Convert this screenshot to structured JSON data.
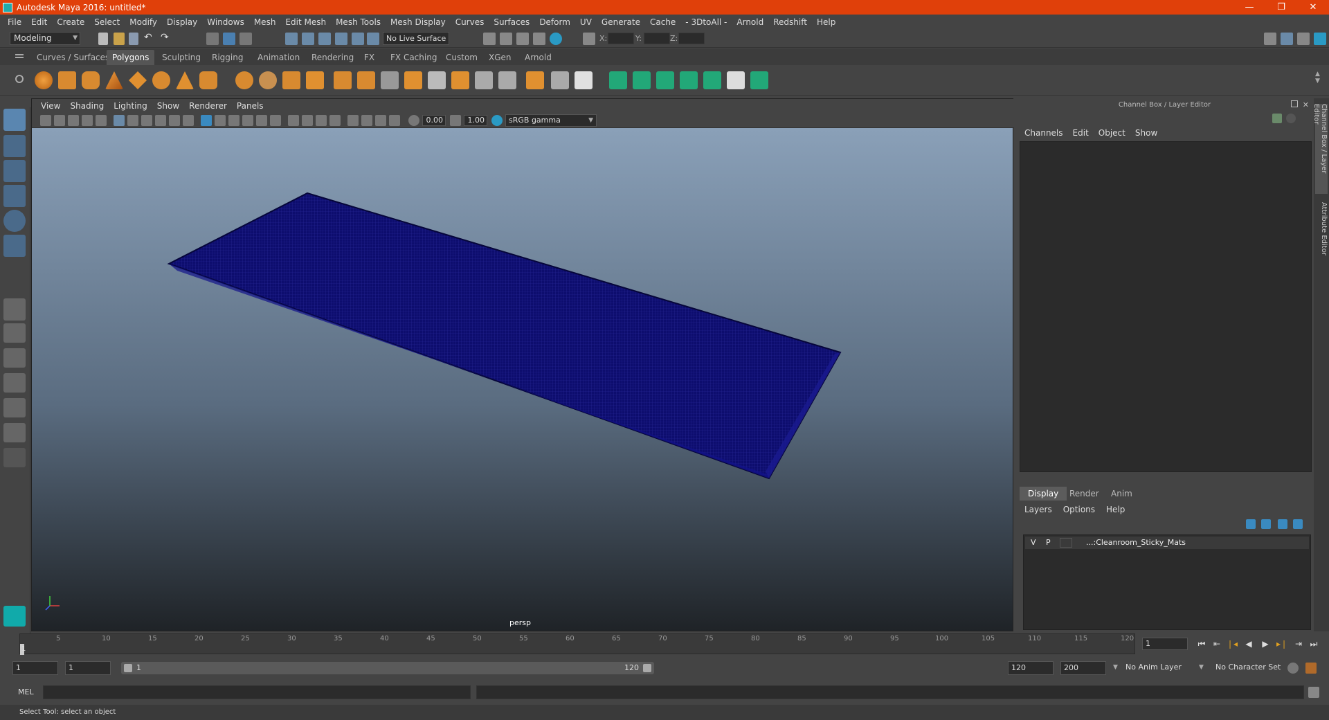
{
  "window": {
    "title": "Autodesk Maya 2016: untitled*",
    "buttons": [
      "—",
      "❐",
      "✕"
    ]
  },
  "menubar": [
    "File",
    "Edit",
    "Create",
    "Select",
    "Modify",
    "Display",
    "Windows",
    "Mesh",
    "Edit Mesh",
    "Mesh Tools",
    "Mesh Display",
    "Curves",
    "Surfaces",
    "Deform",
    "UV",
    "Generate",
    "Cache",
    "- 3DtoAll -",
    "Arnold",
    "Redshift",
    "Help"
  ],
  "status": {
    "mode": "Modeling",
    "live_surface": "No Live Surface",
    "x_label": "X:",
    "y_label": "Y:",
    "z_label": "Z:"
  },
  "shelf_tabs": [
    "Curves / Surfaces",
    "Polygons",
    "Sculpting",
    "Rigging",
    "Animation",
    "Rendering",
    "FX",
    "FX Caching",
    "Custom",
    "XGen",
    "Arnold"
  ],
  "viewport": {
    "menu": [
      "View",
      "Shading",
      "Lighting",
      "Show",
      "Renderer",
      "Panels"
    ],
    "exposure": "0.00",
    "gamma": "1.00",
    "color_space": "sRGB gamma",
    "camera": "persp",
    "mesh_color": "#0d0d6e"
  },
  "right_panel": {
    "title": "Channel Box / Layer Editor",
    "menu": [
      "Channels",
      "Edit",
      "Object",
      "Show"
    ],
    "layer_tabs": [
      "Display",
      "Render",
      "Anim"
    ],
    "layer_menu": [
      "Layers",
      "Options",
      "Help"
    ],
    "layers": [
      {
        "v": "V",
        "p": "P",
        "name": "...:Cleanroom_Sticky_Mats"
      }
    ],
    "side_tabs": [
      "Channel Box / Layer Editor",
      "Attribute Editor"
    ]
  },
  "timeline": {
    "ticks": [
      "5",
      "10",
      "15",
      "20",
      "25",
      "30",
      "35",
      "40",
      "45",
      "50",
      "55",
      "60",
      "65",
      "70",
      "75",
      "80",
      "85",
      "90",
      "95",
      "100",
      "105",
      "110",
      "115",
      "120"
    ],
    "start_label": "1",
    "current_frame": "1",
    "start": "1",
    "range_start": "1",
    "slider_start": "1",
    "slider_end": "120",
    "range_end": "120",
    "end": "200",
    "anim_layer": "No Anim Layer",
    "character_set": "No Character Set"
  },
  "command": {
    "label": "MEL",
    "help_text": "Select Tool: select an object"
  }
}
